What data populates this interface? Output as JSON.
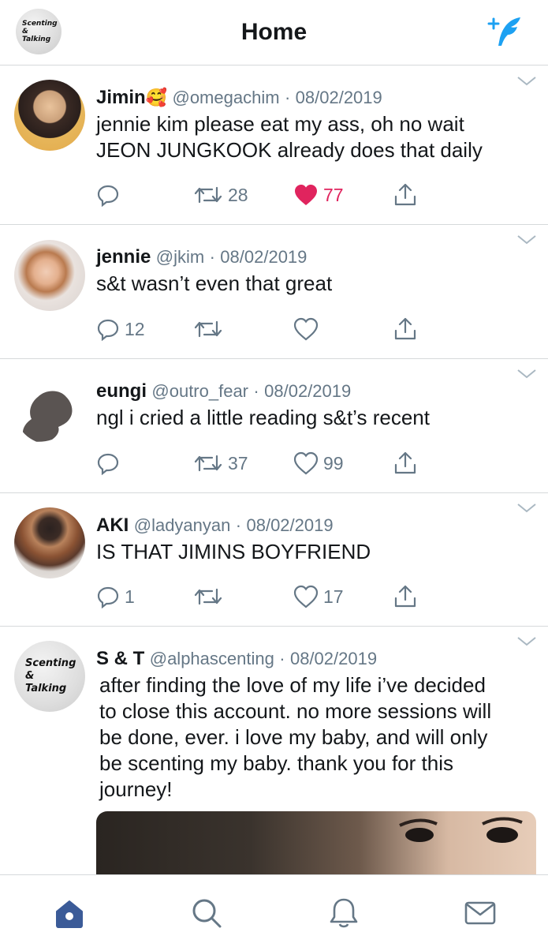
{
  "header": {
    "title": "Home",
    "logo_lines": [
      "Scenting",
      "&",
      "Talking"
    ]
  },
  "tweets": [
    {
      "name": "Jimin",
      "emoji": "🥰",
      "handle": "@omegachim",
      "date": "08/02/2019",
      "text_lines": [
        "jennie kim please eat my ass, oh no wait",
        "JEON JUNGKOOK already does that daily"
      ],
      "replies": "",
      "retweets": "28",
      "likes": "77",
      "liked": true
    },
    {
      "name": "jennie",
      "handle": "@jkim",
      "date": "08/02/2019",
      "text_lines": [
        "s&t wasn’t even that great"
      ],
      "replies": "12",
      "retweets": "",
      "likes": "",
      "liked": false
    },
    {
      "name": "eungi",
      "handle": "@outro_fear",
      "date": "08/02/2019",
      "text_lines": [
        "ngl i cried a little reading s&t’s recent"
      ],
      "replies": "",
      "retweets": "37",
      "likes": "99",
      "liked": false
    },
    {
      "name": "AKI",
      "handle": "@ladyanyan",
      "date": "08/02/2019",
      "text_lines": [
        "IS THAT JIMINS BOYFRIEND"
      ],
      "replies": "1",
      "retweets": "",
      "likes": "17",
      "liked": false
    },
    {
      "name": "S & T",
      "handle": "@alphascenting",
      "date": "08/02/2019",
      "text_lines": [
        "after finding the love of my life i’ve decided",
        "to close this account. no more sessions will",
        "be done, ever. i love my baby, and will only",
        "be scenting my baby. thank you for this",
        "journey!"
      ],
      "avatar_lines": [
        "Scenting",
        "&",
        "Talking"
      ]
    }
  ],
  "tabbar": {
    "tabs": [
      "home-icon",
      "search-icon",
      "bell-icon",
      "mail-icon"
    ],
    "active": "home-icon"
  },
  "colors": {
    "accent": "#1da1f2",
    "home_tab": "#3b5b98",
    "like": "#e0245e",
    "muted": "#657786"
  }
}
